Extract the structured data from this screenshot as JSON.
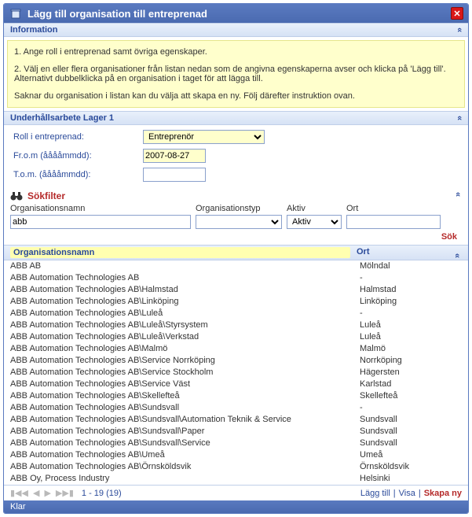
{
  "titlebar": {
    "title": "Lägg till organisation till entreprenad"
  },
  "sections": {
    "information": {
      "label": "Information",
      "p1": "1. Ange roll i entreprenad samt övriga egenskaper.",
      "p2": "2. Välj en eller flera organisationer från listan nedan som de angivna egenskaperna avser och klicka på 'Lägg till'. Alternativt dubbelklicka på en organisation i taget för att lägga till.",
      "p3": "Saknar du organisation i listan kan du välja att skapa en ny. Följ därefter instruktion ovan."
    },
    "underhall": {
      "label": "Underhållsarbete Lager 1",
      "role_label": "Roll i entreprenad:",
      "role_value": "Entreprenör",
      "from_label": "Fr.o.m (ååååmmdd):",
      "from_value": "2007-08-27",
      "tom_label": "T.o.m. (ååååmmdd):",
      "tom_value": ""
    },
    "filter": {
      "label": "Sökfilter",
      "orgnamn_label": "Organisationsnamn",
      "orgnamn_value": "abb",
      "orgtyp_label": "Organisationstyp",
      "orgtyp_value": "",
      "aktiv_label": "Aktiv",
      "aktiv_value": "Aktiv",
      "ort_label": "Ort",
      "ort_value": "",
      "sok": "Sök"
    },
    "table": {
      "col_name": "Organisationsnamn",
      "col_ort": "Ort",
      "rows": [
        {
          "name": "ABB AB",
          "ort": "Mölndal"
        },
        {
          "name": "ABB Automation Technologies AB",
          "ort": "-"
        },
        {
          "name": "ABB Automation Technologies AB\\Halmstad",
          "ort": "Halmstad"
        },
        {
          "name": "ABB Automation Technologies AB\\Linköping",
          "ort": "Linköping"
        },
        {
          "name": "ABB Automation Technologies AB\\Luleå",
          "ort": "-"
        },
        {
          "name": "ABB Automation Technologies AB\\Luleå\\Styrsystem",
          "ort": "Luleå"
        },
        {
          "name": "ABB Automation Technologies AB\\Luleå\\Verkstad",
          "ort": "Luleå"
        },
        {
          "name": "ABB Automation Technologies AB\\Malmö",
          "ort": "Malmö"
        },
        {
          "name": "ABB Automation Technologies AB\\Service Norrköping",
          "ort": "Norrköping"
        },
        {
          "name": "ABB Automation Technologies AB\\Service Stockholm",
          "ort": "Hägersten"
        },
        {
          "name": "ABB Automation Technologies AB\\Service Väst",
          "ort": "Karlstad"
        },
        {
          "name": "ABB Automation Technologies AB\\Skellefteå",
          "ort": "Skellefteå"
        },
        {
          "name": "ABB Automation Technologies AB\\Sundsvall",
          "ort": "-"
        },
        {
          "name": "ABB Automation Technologies AB\\Sundsvall\\Automation Teknik & Service",
          "ort": "Sundsvall"
        },
        {
          "name": "ABB Automation Technologies AB\\Sundsvall\\Paper",
          "ort": "Sundsvall"
        },
        {
          "name": "ABB Automation Technologies AB\\Sundsvall\\Service",
          "ort": "Sundsvall"
        },
        {
          "name": "ABB Automation Technologies AB\\Umeå",
          "ort": "Umeå"
        },
        {
          "name": "ABB Automation Technologies AB\\Örnsköldsvik",
          "ort": "Örnsköldsvik"
        },
        {
          "name": "ABB Oy, Process Industry",
          "ort": "Helsinki"
        }
      ]
    },
    "pager": {
      "info": "1 - 19 (19)",
      "lagg_till": "Lägg till",
      "visa": "Visa",
      "skapa_ny": "Skapa ny"
    }
  },
  "statusbar": {
    "text": "Klar"
  },
  "collapse_glyph": "«"
}
